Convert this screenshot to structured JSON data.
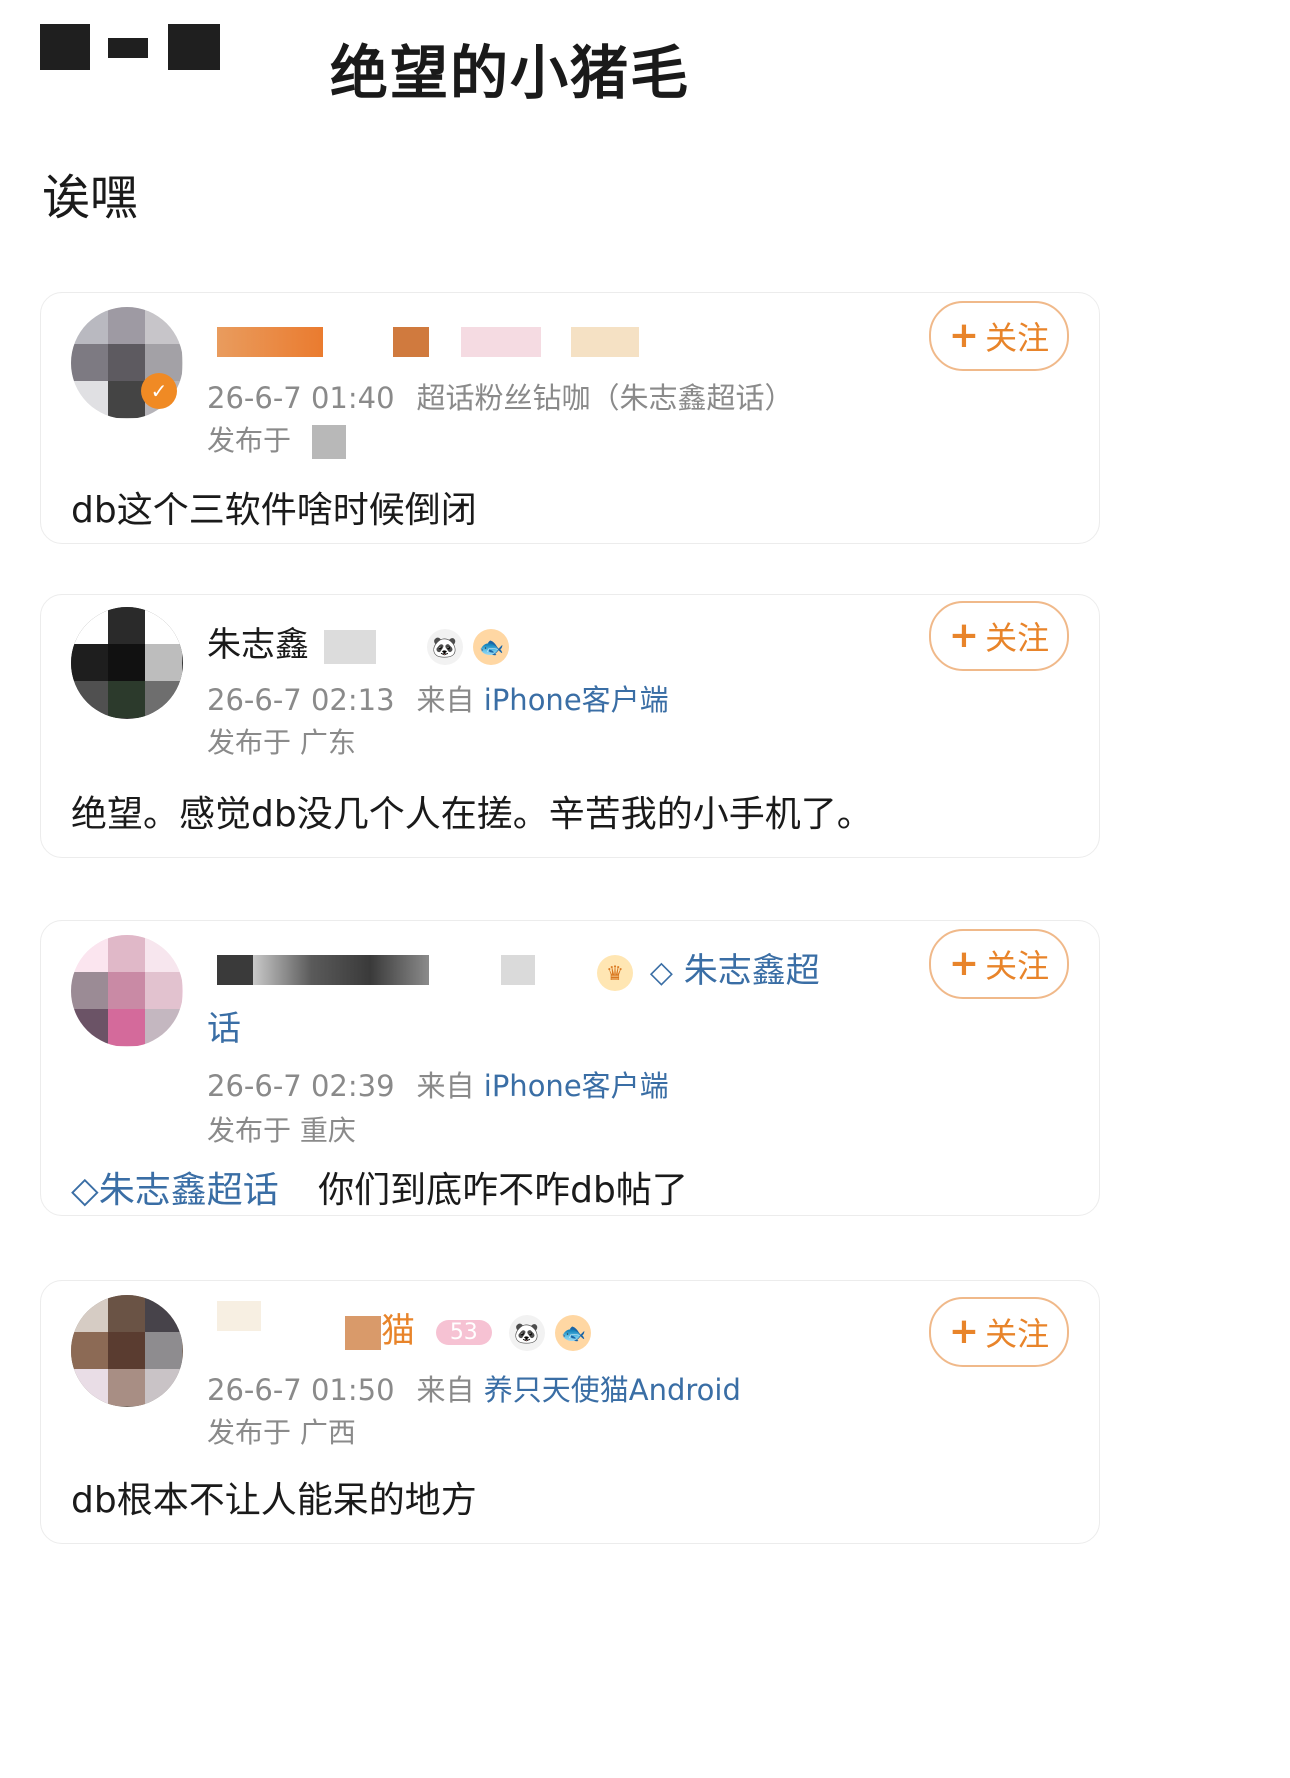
{
  "header": {
    "title": "绝望的小猪毛",
    "caption": "诶嘿"
  },
  "comments": [
    {
      "meta_time": "26-6-7 01:40",
      "meta_label": "超话粉丝钻咖（朱志鑫超话）",
      "location": "发布于",
      "text": "db这个三软件啥时候倒闭",
      "follow": "关注"
    },
    {
      "username": "朱志鑫",
      "meta_time": "26-6-7 02:13",
      "meta_from": "来自",
      "meta_source": "iPhone客户端",
      "location": "发布于 广东",
      "text": "绝望。感觉db没几个人在搓。辛苦我的小手机了。",
      "follow": "关注"
    },
    {
      "topic_name": "朱志鑫超",
      "topic_name_tail": "话",
      "meta_time": "26-6-7 02:39",
      "meta_from": "来自",
      "meta_source": "iPhone客户端",
      "location": "发布于 重庆",
      "topic_tag": "朱志鑫超话",
      "text": "你们到底咋不咋db帖了",
      "follow": "关注"
    },
    {
      "username_tail": "猫",
      "level": "53",
      "meta_time": "26-6-7 01:50",
      "meta_from": "来自",
      "meta_source": "养只天使猫Android",
      "location": "发布于 广西",
      "text": "db根本不让人能呆的地方",
      "follow": "关注"
    }
  ],
  "colors": {
    "accent_orange": "#e8842a",
    "link_blue": "#3a6ea5",
    "meta_gray": "#8a8a8a"
  }
}
